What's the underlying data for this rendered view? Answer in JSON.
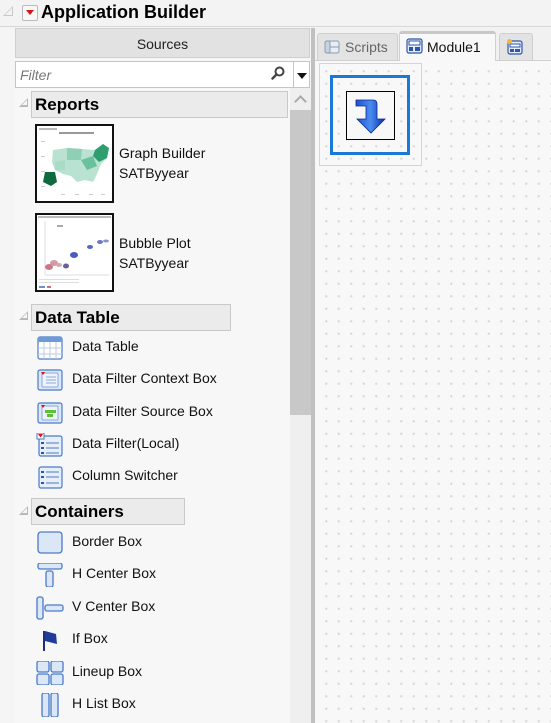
{
  "title": "Application Builder",
  "sources": {
    "header": "Sources",
    "filter_placeholder": "Filter",
    "filter_value": ""
  },
  "sections": {
    "reports": {
      "title": "Reports",
      "items": [
        {
          "line1": "Graph Builder",
          "line2": "SATByyear",
          "thumbnail": "us-map-chart"
        },
        {
          "line1": "Bubble Plot",
          "line2": "SATByyear",
          "thumbnail": "bubble-plot-chart"
        }
      ]
    },
    "data_table": {
      "title": "Data Table",
      "items": [
        {
          "label": "Data Table",
          "icon": "data-table-icon"
        },
        {
          "label": "Data Filter Context Box",
          "icon": "data-filter-context-box-icon"
        },
        {
          "label": "Data Filter Source Box",
          "icon": "data-filter-source-box-icon"
        },
        {
          "label": "Data Filter(Local)",
          "icon": "data-filter-local-icon"
        },
        {
          "label": "Column Switcher",
          "icon": "column-switcher-icon"
        }
      ]
    },
    "containers": {
      "title": "Containers",
      "items": [
        {
          "label": "Border Box",
          "icon": "border-box-icon"
        },
        {
          "label": "H Center Box",
          "icon": "h-center-box-icon"
        },
        {
          "label": "V Center Box",
          "icon": "v-center-box-icon"
        },
        {
          "label": "If Box",
          "icon": "flag-icon"
        },
        {
          "label": "Lineup Box",
          "icon": "lineup-box-icon"
        },
        {
          "label": "H List Box",
          "icon": "h-list-box-icon"
        }
      ]
    }
  },
  "tabs": [
    {
      "label": "Scripts",
      "icon": "script-icon",
      "active": false
    },
    {
      "label": "Module1",
      "icon": "module-icon",
      "active": true
    },
    {
      "label": "",
      "icon": "new-module-icon",
      "active": false
    }
  ],
  "colors": {
    "selection": "#1a79d6",
    "accent_red": "#d2161c",
    "filter_border": "#9ed1ee"
  }
}
